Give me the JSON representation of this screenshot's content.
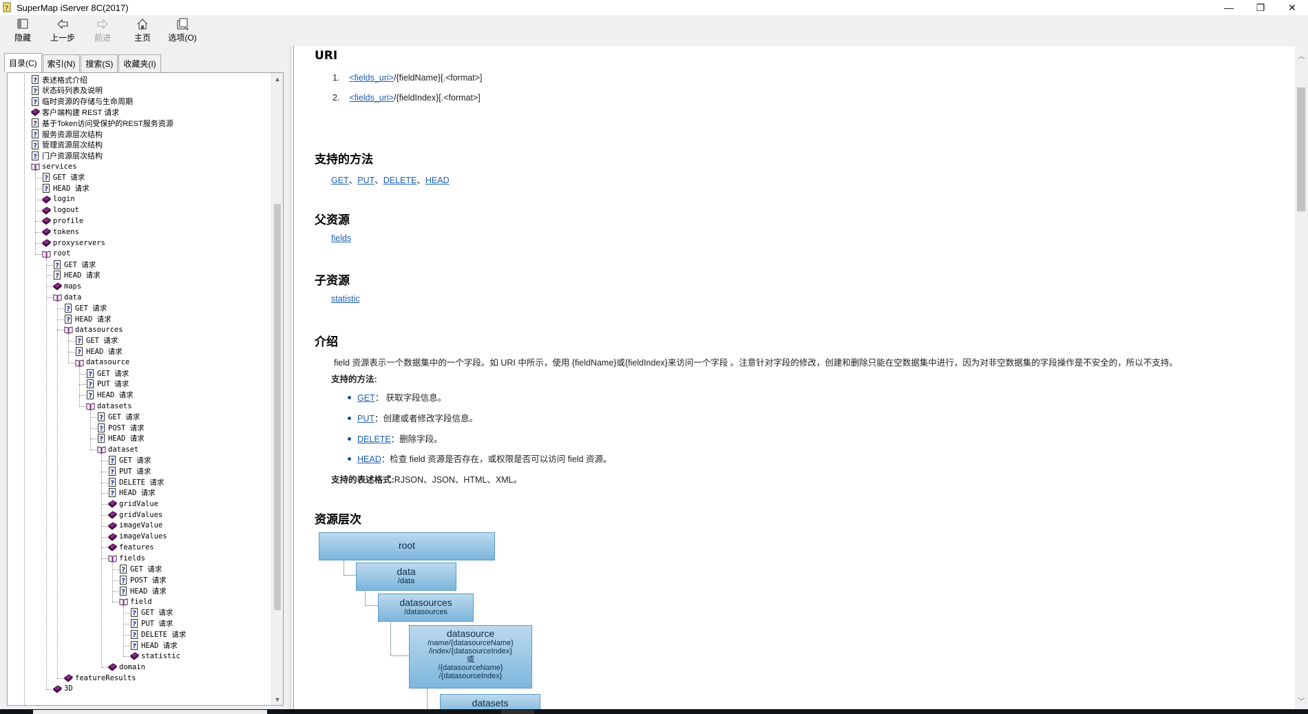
{
  "window": {
    "title": "SuperMap iServer 8C(2017)",
    "controls": [
      "minimize",
      "restore",
      "close"
    ]
  },
  "toolbar": {
    "buttons": [
      {
        "label": "隐藏",
        "icon": "hide-icon",
        "enabled": true
      },
      {
        "label": "上一步",
        "icon": "back-arrow-icon",
        "enabled": true
      },
      {
        "label": "前进",
        "icon": "forward-arrow-icon",
        "enabled": false
      },
      {
        "label": "主页",
        "icon": "home-icon",
        "enabled": true
      },
      {
        "label": "选项(O)",
        "icon": "options-icon",
        "enabled": true
      }
    ]
  },
  "nav": {
    "tabs": [
      "目录(C)",
      "索引(N)",
      "搜索(S)",
      "收藏夹(I)"
    ],
    "active_tab": 0,
    "tree": [
      {
        "label": "表述格式介绍",
        "level": 0,
        "type": "page",
        "mono": false
      },
      {
        "label": "状态码列表及说明",
        "level": 0,
        "type": "page",
        "mono": false
      },
      {
        "label": "临时资源的存储与生命周期",
        "level": 0,
        "type": "page",
        "mono": false
      },
      {
        "label": "客户端构建 REST 请求",
        "level": 0,
        "type": "book",
        "mono": false
      },
      {
        "label": "基于Token访问受保护的REST服务资源",
        "level": 0,
        "type": "page",
        "mono": false
      },
      {
        "label": "服务资源层次结构",
        "level": 0,
        "type": "page",
        "mono": false
      },
      {
        "label": "管理资源层次结构",
        "level": 0,
        "type": "page",
        "mono": false
      },
      {
        "label": "门户资源层次结构",
        "level": 0,
        "type": "page",
        "mono": false
      },
      {
        "label": "services",
        "level": 0,
        "type": "open",
        "mono": true
      },
      {
        "label": "GET 请求",
        "level": 1,
        "type": "page",
        "mono": true
      },
      {
        "label": "HEAD 请求",
        "level": 1,
        "type": "page",
        "mono": true
      },
      {
        "label": "login",
        "level": 1,
        "type": "book",
        "mono": true
      },
      {
        "label": "logout",
        "level": 1,
        "type": "book",
        "mono": true
      },
      {
        "label": "profile",
        "level": 1,
        "type": "book",
        "mono": true
      },
      {
        "label": "tokens",
        "level": 1,
        "type": "book",
        "mono": true
      },
      {
        "label": "proxyservers",
        "level": 1,
        "type": "book",
        "mono": true
      },
      {
        "label": "root",
        "level": 1,
        "type": "open",
        "mono": true
      },
      {
        "label": "GET 请求",
        "level": 2,
        "type": "page",
        "mono": true
      },
      {
        "label": "HEAD 请求",
        "level": 2,
        "type": "page",
        "mono": true
      },
      {
        "label": "maps",
        "level": 2,
        "type": "book",
        "mono": true
      },
      {
        "label": "data",
        "level": 2,
        "type": "open",
        "mono": true
      },
      {
        "label": "GET 请求",
        "level": 3,
        "type": "page",
        "mono": true
      },
      {
        "label": "HEAD 请求",
        "level": 3,
        "type": "page",
        "mono": true
      },
      {
        "label": "datasources",
        "level": 3,
        "type": "open",
        "mono": true
      },
      {
        "label": "GET 请求",
        "level": 4,
        "type": "page",
        "mono": true
      },
      {
        "label": "HEAD 请求",
        "level": 4,
        "type": "page",
        "mono": true
      },
      {
        "label": "datasource",
        "level": 4,
        "type": "open",
        "mono": true
      },
      {
        "label": "GET 请求",
        "level": 5,
        "type": "page",
        "mono": true
      },
      {
        "label": "PUT 请求",
        "level": 5,
        "type": "page",
        "mono": true
      },
      {
        "label": "HEAD 请求",
        "level": 5,
        "type": "page",
        "mono": true
      },
      {
        "label": "datasets",
        "level": 5,
        "type": "open",
        "mono": true
      },
      {
        "label": "GET 请求",
        "level": 6,
        "type": "page",
        "mono": true
      },
      {
        "label": "POST 请求",
        "level": 6,
        "type": "page",
        "mono": true
      },
      {
        "label": "HEAD 请求",
        "level": 6,
        "type": "page",
        "mono": true
      },
      {
        "label": "dataset",
        "level": 6,
        "type": "open",
        "mono": true
      },
      {
        "label": "GET 请求",
        "level": 7,
        "type": "page",
        "mono": true
      },
      {
        "label": "PUT 请求",
        "level": 7,
        "type": "page",
        "mono": true
      },
      {
        "label": "DELETE 请求",
        "level": 7,
        "type": "page",
        "mono": true
      },
      {
        "label": "HEAD 请求",
        "level": 7,
        "type": "page",
        "mono": true
      },
      {
        "label": "gridValue",
        "level": 7,
        "type": "book",
        "mono": true
      },
      {
        "label": "gridValues",
        "level": 7,
        "type": "book",
        "mono": true
      },
      {
        "label": "imageValue",
        "level": 7,
        "type": "book",
        "mono": true
      },
      {
        "label": "imageValues",
        "level": 7,
        "type": "book",
        "mono": true
      },
      {
        "label": "features",
        "level": 7,
        "type": "book",
        "mono": true
      },
      {
        "label": "fields",
        "level": 7,
        "type": "open",
        "mono": true
      },
      {
        "label": "GET 请求",
        "level": 8,
        "type": "page",
        "mono": true
      },
      {
        "label": "POST 请求",
        "level": 8,
        "type": "page",
        "mono": true
      },
      {
        "label": "HEAD 请求",
        "level": 8,
        "type": "page",
        "mono": true
      },
      {
        "label": "field",
        "level": 8,
        "type": "open",
        "mono": true
      },
      {
        "label": "GET 请求",
        "level": 9,
        "type": "page",
        "mono": true
      },
      {
        "label": "PUT 请求",
        "level": 9,
        "type": "page",
        "mono": true
      },
      {
        "label": "DELETE 请求",
        "level": 9,
        "type": "page",
        "mono": true
      },
      {
        "label": "HEAD 请求",
        "level": 9,
        "type": "page",
        "mono": true
      },
      {
        "label": "statistic",
        "level": 9,
        "type": "book",
        "mono": true
      },
      {
        "label": "domain",
        "level": 7,
        "type": "book",
        "mono": true
      },
      {
        "label": "featureResults",
        "level": 3,
        "type": "book",
        "mono": true
      },
      {
        "label": "3D",
        "level": 2,
        "type": "book",
        "mono": true
      }
    ]
  },
  "content": {
    "uri_heading": "URI",
    "uri_items": [
      {
        "num": "1.",
        "link": "<fields_uri>",
        "rest": "/{fieldName}[.<format>]"
      },
      {
        "num": "2.",
        "link": "<fields_uri>",
        "rest": "/{fieldIndex}[.<format>]"
      }
    ],
    "methods_heading": "支持的方法",
    "methods": [
      "GET",
      "PUT",
      "DELETE",
      "HEAD"
    ],
    "methods_sep": "、",
    "parent_heading": "父资源",
    "parent": "fields",
    "child_heading": "子资源",
    "child": "statistic",
    "intro_heading": "介绍",
    "intro_text": "field 资源表示一个数据集中的一个字段。如 URI 中所示，使用 {fieldName}或{fieldIndex}来访问一个字段 。注意针对字段的修改，创建和删除只能在空数据集中进行，因为对非空数据集的字段操作是不安全的，所以不支持。",
    "supported_methods_label": "支持的方法:",
    "method_details": [
      {
        "method": "GET",
        "desc": "：  获取字段信息。"
      },
      {
        "method": "PUT",
        "desc": "：创建或者修改字段信息。"
      },
      {
        "method": "DELETE",
        "desc": "：删除字段。"
      },
      {
        "method": "HEAD",
        "desc": "：检查 field 资源是否存在，或权限是否可以访问 field 资源。"
      }
    ],
    "formats_label": "支持的表述格式:",
    "formats": "RJSON、JSON、HTML、XML。",
    "hierarchy_heading": "资源层次",
    "hierarchy": [
      {
        "name": "root",
        "paths": []
      },
      {
        "name": "data",
        "paths": [
          "/data"
        ]
      },
      {
        "name": "datasources",
        "paths": [
          "/datasources"
        ]
      },
      {
        "name": "datasource",
        "paths": [
          "/name/{datasourceName}",
          "/index/{datasourceIndex}",
          "或",
          "/{datasourceName}",
          "/{datasourceIndex}"
        ]
      },
      {
        "name": "datasets",
        "paths": []
      }
    ]
  },
  "colors": {
    "link": "#1a5fb4",
    "hierarchy_box": "#7db6dc",
    "book_icon": "#7a1f7a"
  }
}
